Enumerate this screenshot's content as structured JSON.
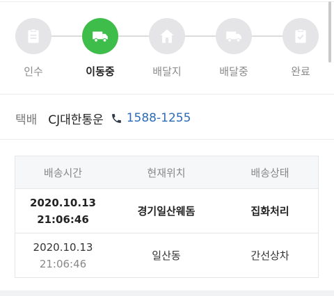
{
  "stepper": {
    "steps": [
      {
        "label": "인수",
        "icon": "clipboard-icon",
        "active": false
      },
      {
        "label": "이동중",
        "icon": "truck-icon",
        "active": true
      },
      {
        "label": "배달지",
        "icon": "house-icon",
        "active": false
      },
      {
        "label": "배달중",
        "icon": "truck-icon",
        "active": false
      },
      {
        "label": "완료",
        "icon": "clipboard-check-icon",
        "active": false
      }
    ],
    "active_color": "#3fbd4b",
    "inactive_color": "#e5e5e8"
  },
  "courier": {
    "key_label": "택배",
    "name": "CJ대한통운",
    "phone_icon": "phone-icon",
    "phone": "1588-1255",
    "phone_color": "#2c6bb6"
  },
  "tracking_table": {
    "headers": [
      "배송시간",
      "현재위치",
      "배송상태"
    ],
    "rows": [
      {
        "date": "2020.10.13",
        "time": "21:06:46",
        "location": "경기일산웨돔",
        "status": "집화처리"
      },
      {
        "date": "2020.10.13",
        "time": "21:06:46",
        "location": "일산동",
        "status": "간선상차"
      }
    ]
  }
}
